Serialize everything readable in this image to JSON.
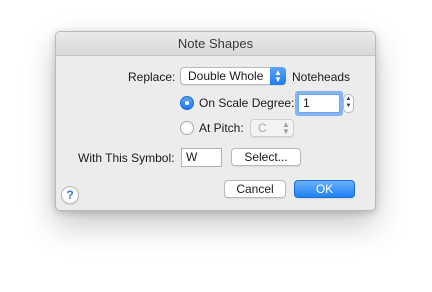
{
  "dialog": {
    "title": "Note Shapes"
  },
  "replace_row": {
    "label": "Replace:",
    "popup_value": "Double Whole",
    "suffix": "Noteheads"
  },
  "options": {
    "scale_degree": {
      "label": "On Scale Degree:",
      "selected": true,
      "value": "1"
    },
    "pitch": {
      "label": "At Pitch:",
      "selected": false,
      "value": "C"
    }
  },
  "symbol_row": {
    "label": "With This Symbol:",
    "value": "W",
    "select_button": "Select..."
  },
  "buttons": {
    "help": "?",
    "cancel": "Cancel",
    "ok": "OK"
  },
  "icons": {
    "popup_arrows": "⌃⌄",
    "stepper_arrows": "▲▼"
  }
}
